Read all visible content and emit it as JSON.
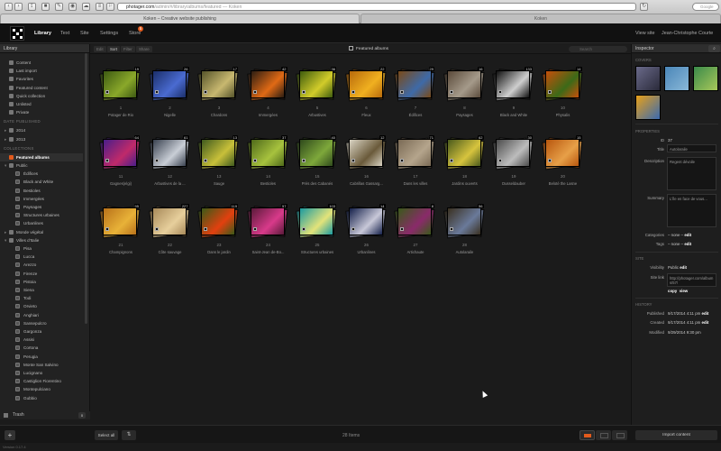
{
  "browser": {
    "url_host": "photager.com",
    "url_path": "/admin/#/library/albums/featured",
    "url_suffix": " — Koken",
    "search_placeholder": "Google",
    "tab1": "Koken – Creative website publishing",
    "tab2": "Koken"
  },
  "topnav": {
    "items": [
      "Library",
      "Text",
      "Site",
      "Settings",
      "Store"
    ],
    "store_badge": "5",
    "view_site": "View site",
    "user": "Jean-Christophe Courte"
  },
  "sidebar": {
    "title": "Library",
    "library_items": [
      "Content",
      "Last import",
      "Favorites",
      "Featured content",
      "Quick collection",
      "Unlisted",
      "Private"
    ],
    "date_header": "DATE PUBLISHED",
    "dates": [
      "2014",
      "2013"
    ],
    "collections_header": "COLLECTIONS",
    "featured": "Featured albums",
    "public": "Public",
    "public_children": [
      "Édifices",
      "Black and White",
      "Bestioles",
      "Immergées",
      "Paysages",
      "Structures urbaines",
      "Urbanlines"
    ],
    "monde": "Monde végétal",
    "villes": "Villes d'Italie",
    "villes_children": [
      "Pisa",
      "Lucca",
      "Arezzo",
      "Firenze",
      "Pistoia",
      "Siena",
      "Todi",
      "Orvieto",
      "Anghiari",
      "Sansepulcro",
      "Gargonza",
      "Assisi",
      "Cortona",
      "Perugia",
      "Monte San Salvino",
      "Lucignano",
      "Castiglion Fiorentino",
      "Montepulciano",
      "Gubbio"
    ],
    "trash": "Trash",
    "trash_count": "0"
  },
  "toolbar": {
    "buttons": [
      "Edit",
      "Sort",
      "Filter",
      "Share"
    ],
    "album_title": "Featured albums",
    "search_placeholder": "Search"
  },
  "albums": [
    {
      "num": "1",
      "name": "Potager de Rio",
      "count": "19",
      "colors": [
        "#3d5a12",
        "#8aa82a"
      ]
    },
    {
      "num": "2",
      "name": "Nigelle",
      "count": "26",
      "colors": [
        "#1b2f6a",
        "#4a6bd1"
      ]
    },
    {
      "num": "3",
      "name": "Chardons",
      "count": "17",
      "colors": [
        "#56542a",
        "#c8b870"
      ]
    },
    {
      "num": "4",
      "name": "Immergées",
      "count": "42",
      "colors": [
        "#2c1d12",
        "#e06a15"
      ]
    },
    {
      "num": "5",
      "name": "Arbustives",
      "count": "36",
      "colors": [
        "#3e5c0d",
        "#d2cc2a"
      ]
    },
    {
      "num": "6",
      "name": "Fleux",
      "count": "22",
      "colors": [
        "#b86a0b",
        "#f0b020"
      ]
    },
    {
      "num": "7",
      "name": "Édifices",
      "count": "29",
      "colors": [
        "#7a4a18",
        "#3e6aa8"
      ]
    },
    {
      "num": "8",
      "name": "Paysages",
      "count": "16",
      "colors": [
        "#5a4a3a",
        "#a59a8a"
      ]
    },
    {
      "num": "9",
      "name": "Black and White",
      "count": "133",
      "colors": [
        "#111111",
        "#cfcfcf"
      ]
    },
    {
      "num": "10",
      "name": "Physalis",
      "count": "14",
      "colors": [
        "#c64f0a",
        "#3c6a18"
      ]
    },
    {
      "num": "11",
      "name": "Gagnes(elgi)",
      "count": "64",
      "colors": [
        "#4a1e8a",
        "#c02a6a"
      ]
    },
    {
      "num": "12",
      "name": "Arbustives de la ...",
      "count": "61",
      "colors": [
        "#3a4250",
        "#c9ced6"
      ]
    },
    {
      "num": "13",
      "name": "Sauge",
      "count": "13",
      "colors": [
        "#3f5a1e",
        "#c8c03a"
      ]
    },
    {
      "num": "14",
      "name": "Bestioles",
      "count": "37",
      "colors": [
        "#4f6a1a",
        "#a7c23e"
      ]
    },
    {
      "num": "15",
      "name": "Près des Cabanés",
      "count": "40",
      "colors": [
        "#2f4a1c",
        "#7ea83b"
      ]
    },
    {
      "num": "16",
      "name": "Cabrillas Gassarg...",
      "count": "12",
      "colors": [
        "#d8d2c2",
        "#6a5a3a"
      ]
    },
    {
      "num": "17",
      "name": "Dans les villes",
      "count": "71",
      "colors": [
        "#7a6a55",
        "#b5a58c"
      ]
    },
    {
      "num": "18",
      "name": "Jardins ouverts",
      "count": "62",
      "colors": [
        "#4a5a1c",
        "#d7c43e"
      ]
    },
    {
      "num": "19",
      "name": "Dusseldauber",
      "count": "30",
      "colors": [
        "#4b4b4b",
        "#bdbdbd"
      ]
    },
    {
      "num": "20",
      "name": "Beloté the Lasne",
      "count": "15",
      "colors": [
        "#b8560e",
        "#e7a048"
      ]
    },
    {
      "num": "21",
      "name": "Champignons",
      "count": "95",
      "colors": [
        "#b9721a",
        "#e8b238"
      ]
    },
    {
      "num": "22",
      "name": "Côte sauvage",
      "count": "227",
      "colors": [
        "#a88a5a",
        "#e7cf9c"
      ]
    },
    {
      "num": "23",
      "name": "Dans le jardin",
      "count": "119",
      "colors": [
        "#3b5a18",
        "#e2400f"
      ]
    },
    {
      "num": "24",
      "name": "Saint-Jean de-Bo...",
      "count": "57",
      "colors": [
        "#5a1a3a",
        "#d83a8a"
      ]
    },
    {
      "num": "25",
      "name": "Structures urbaines",
      "count": "103",
      "colors": [
        "#1a9aa0",
        "#e3e37a"
      ]
    },
    {
      "num": "26",
      "name": "Urbanlines",
      "count": "14",
      "colors": [
        "#14204a",
        "#c8c8d8"
      ]
    },
    {
      "num": "27",
      "name": "Artichaute",
      "count": "8",
      "colors": [
        "#3a5a1a",
        "#8a2a6a"
      ]
    },
    {
      "num": "28",
      "name": "Autolaraile",
      "count": "56",
      "colors": [
        "#3a3020",
        "#6a7a9a"
      ]
    }
  ],
  "bottombar": {
    "select_all": "Select all",
    "item_count": "28 Items",
    "import": "Import content",
    "version": "Version 0.17.4"
  },
  "inspector": {
    "title": "Inspector",
    "covers_header": "COVERS",
    "properties_header": "PROPERTIES",
    "id_label": "ID",
    "id_value": "37",
    "title_label": "Title",
    "title_value": "Autolaraile",
    "description_label": "Description",
    "description_value": "Regent dévoile",
    "summary_label": "Summary",
    "summary_value": "L'île en face de vous...",
    "categories_label": "Categories",
    "categories_value": "– none –",
    "tags_label": "Tags",
    "tags_value": "– none –",
    "edit": "edit",
    "site_header": "SITE",
    "visibility_label": "Visibility",
    "visibility_value": "Public",
    "sitelink_label": "Site link",
    "sitelink_value": "http://photager.com/albums/57/",
    "copy": "copy",
    "view": "view",
    "history_header": "HISTORY",
    "published_label": "Published",
    "published_value": "9/17/2014 4:11 pm",
    "created_label": "Created",
    "created_value": "9/17/2014 4:11 pm",
    "modified_label": "Modified",
    "modified_value": "9/29/2014 9:30 pm"
  }
}
